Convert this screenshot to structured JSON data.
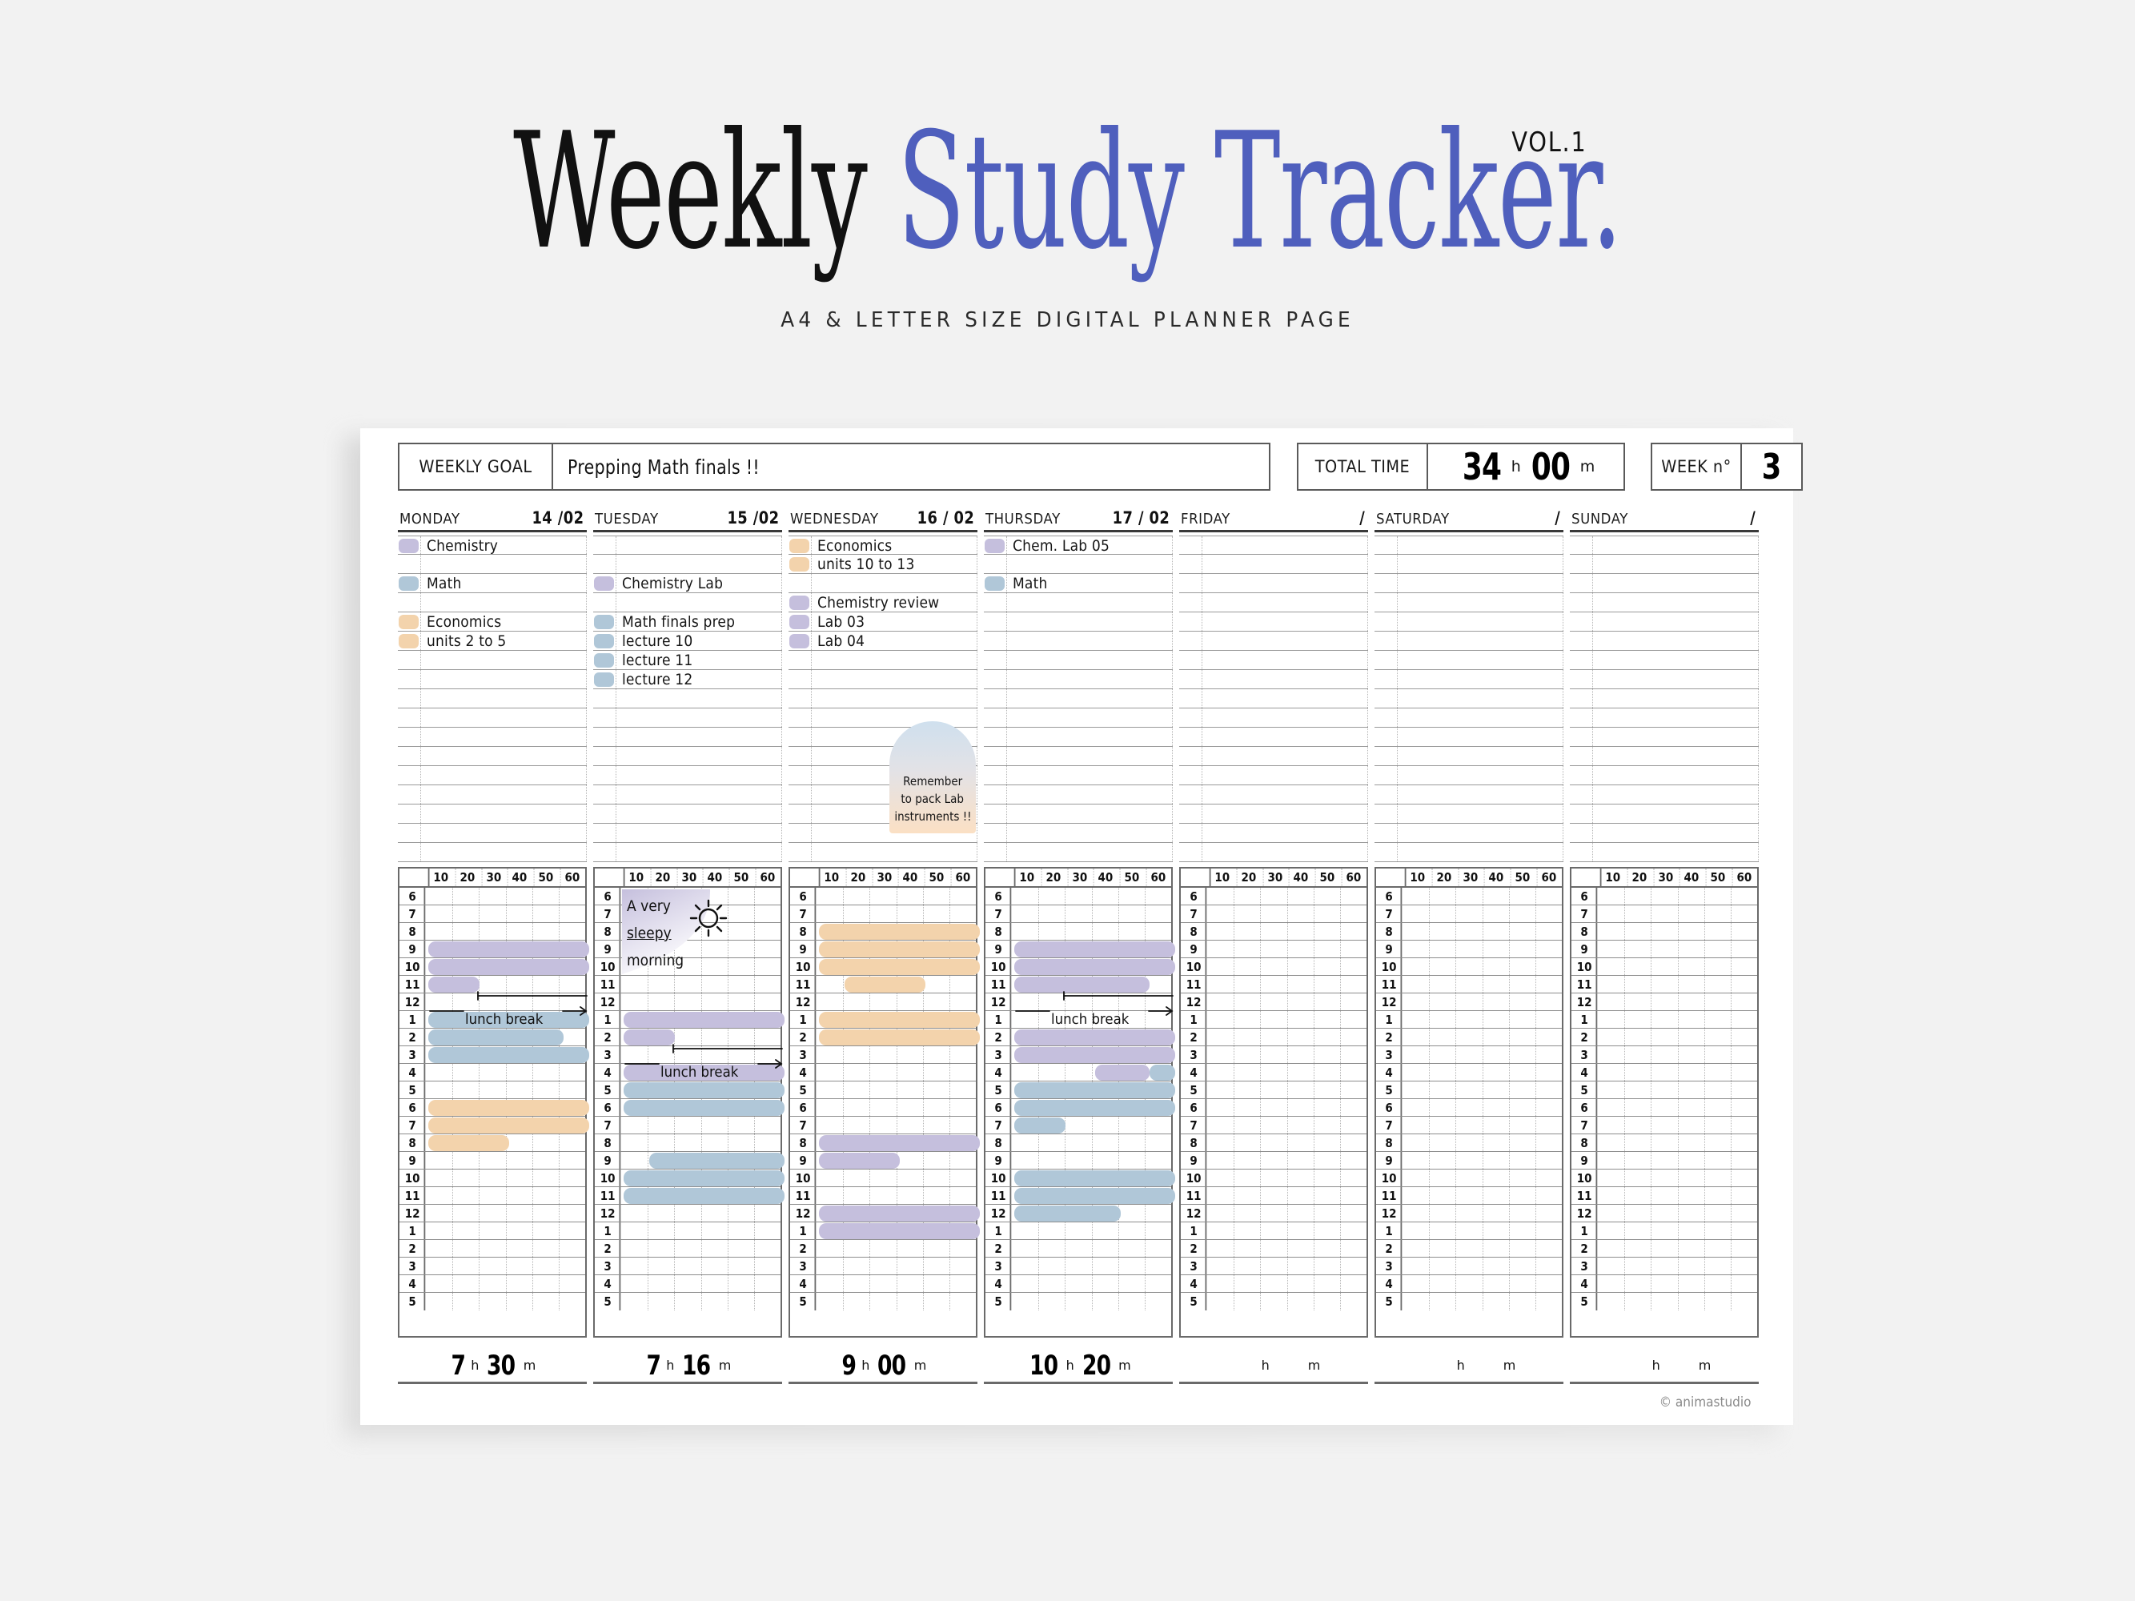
{
  "hero": {
    "title_part1": "Weekly",
    "title_part2": "Study Tracker",
    "title_dot": ".",
    "volume": "VOL.1",
    "subtitle": "A4 & LETTER SIZE DIGITAL PLANNER PAGE"
  },
  "header": {
    "weekly_goal_label": "WEEKLY GOAL",
    "weekly_goal_value": "Prepping Math finals !!",
    "total_time_label": "TOTAL TIME",
    "total_hours": "34",
    "total_hours_unit": "h",
    "total_minutes": "00",
    "total_minutes_unit": "m",
    "week_label": "WEEK n°",
    "week_value": "3"
  },
  "colors": {
    "purple": "#c5bfdd",
    "blue": "#b0c7d8",
    "orange": "#f3d3ac",
    "accent_blue": "#4f5fbd",
    "rule": "#6a6a6a"
  },
  "grid_header_minutes": [
    "10",
    "20",
    "30",
    "40",
    "50",
    "60"
  ],
  "grid_hours": [
    "6",
    "7",
    "8",
    "9",
    "10",
    "11",
    "12",
    "1",
    "2",
    "3",
    "4",
    "5",
    "6",
    "7",
    "8",
    "9",
    "10",
    "11",
    "12",
    "1",
    "2",
    "3",
    "4",
    "5"
  ],
  "days": [
    {
      "name": "MONDAY",
      "date": "14 /02",
      "tasks": [
        {
          "row": 0,
          "chip": "purple",
          "text": "Chemistry"
        },
        {
          "row": 2,
          "chip": "blue",
          "text": "Math"
        },
        {
          "row": 4,
          "chip": "orange",
          "text": "Economics"
        },
        {
          "row": 5,
          "chip": "orange",
          "text": "units 2 to 5"
        }
      ],
      "note": null,
      "sticker": null,
      "bars": [
        {
          "row": 3,
          "start": 0,
          "end": 100,
          "color": "purple"
        },
        {
          "row": 4,
          "start": 0,
          "end": 100,
          "color": "purple"
        },
        {
          "row": 5,
          "start": 0,
          "end": 32,
          "color": "purple"
        },
        {
          "row": 7,
          "start": 0,
          "end": 100,
          "color": "blue"
        },
        {
          "row": 8,
          "start": 0,
          "end": 84,
          "color": "blue"
        },
        {
          "row": 9,
          "start": 0,
          "end": 100,
          "color": "blue"
        },
        {
          "row": 12,
          "start": 0,
          "end": 100,
          "color": "orange"
        },
        {
          "row": 13,
          "start": 0,
          "end": 100,
          "color": "orange"
        },
        {
          "row": 14,
          "start": 0,
          "end": 50,
          "color": "orange"
        }
      ],
      "lunch": {
        "label": "lunch break",
        "row": 6
      },
      "total_hours": "7",
      "total_minutes": "30"
    },
    {
      "name": "TUESDAY",
      "date": "15 /02",
      "tasks": [
        {
          "row": 2,
          "chip": "purple",
          "text": "Chemistry Lab"
        },
        {
          "row": 4,
          "chip": "blue",
          "text": "Math finals prep"
        },
        {
          "row": 5,
          "chip": "blue",
          "text": "lecture 10"
        },
        {
          "row": 6,
          "chip": "blue",
          "text": "lecture 11"
        },
        {
          "row": 7,
          "chip": "blue",
          "text": "lecture 12"
        }
      ],
      "note": null,
      "sticker": {
        "lines": [
          "A very",
          "sleepy",
          "morning"
        ],
        "icon": "sun-icon"
      },
      "bars": [
        {
          "row": 7,
          "start": 0,
          "end": 100,
          "color": "purple"
        },
        {
          "row": 8,
          "start": 0,
          "end": 32,
          "color": "purple"
        },
        {
          "row": 10,
          "start": 0,
          "end": 100,
          "color": "purple"
        },
        {
          "row": 11,
          "start": 0,
          "end": 100,
          "color": "blue"
        },
        {
          "row": 12,
          "start": 0,
          "end": 100,
          "color": "blue"
        },
        {
          "row": 15,
          "start": 16,
          "end": 100,
          "color": "blue"
        },
        {
          "row": 16,
          "start": 0,
          "end": 100,
          "color": "blue"
        },
        {
          "row": 17,
          "start": 0,
          "end": 100,
          "color": "blue"
        }
      ],
      "lunch": {
        "label": "lunch break",
        "row": 9
      },
      "total_hours": "7",
      "total_minutes": "16"
    },
    {
      "name": "WEDNESDAY",
      "date": "16 / 02",
      "tasks": [
        {
          "row": 0,
          "chip": "orange",
          "text": "Economics"
        },
        {
          "row": 1,
          "chip": "orange",
          "text": "units 10 to 13"
        },
        {
          "row": 3,
          "chip": "purple",
          "text": "Chemistry review"
        },
        {
          "row": 4,
          "chip": "purple",
          "text": "Lab 03"
        },
        {
          "row": 5,
          "chip": "purple",
          "text": "Lab 04"
        }
      ],
      "note": {
        "lines": [
          "Remember",
          "to pack Lab",
          "instruments !!"
        ]
      },
      "sticker": null,
      "bars": [
        {
          "row": 2,
          "start": 0,
          "end": 100,
          "color": "orange"
        },
        {
          "row": 3,
          "start": 0,
          "end": 100,
          "color": "orange"
        },
        {
          "row": 4,
          "start": 0,
          "end": 100,
          "color": "orange"
        },
        {
          "row": 5,
          "start": 16,
          "end": 66,
          "color": "orange"
        },
        {
          "row": 7,
          "start": 0,
          "end": 100,
          "color": "orange"
        },
        {
          "row": 8,
          "start": 0,
          "end": 100,
          "color": "orange"
        },
        {
          "row": 14,
          "start": 0,
          "end": 100,
          "color": "purple"
        },
        {
          "row": 15,
          "start": 0,
          "end": 50,
          "color": "purple"
        },
        {
          "row": 18,
          "start": 0,
          "end": 100,
          "color": "purple"
        },
        {
          "row": 19,
          "start": 0,
          "end": 100,
          "color": "purple"
        }
      ],
      "lunch": null,
      "total_hours": "9",
      "total_minutes": "00"
    },
    {
      "name": "THURSDAY",
      "date": "17 / 02",
      "tasks": [
        {
          "row": 0,
          "chip": "purple",
          "text": "Chem. Lab 05"
        },
        {
          "row": 2,
          "chip": "blue",
          "text": "Math"
        }
      ],
      "note": null,
      "sticker": null,
      "bars": [
        {
          "row": 3,
          "start": 0,
          "end": 100,
          "color": "purple"
        },
        {
          "row": 4,
          "start": 0,
          "end": 100,
          "color": "purple"
        },
        {
          "row": 5,
          "start": 0,
          "end": 84,
          "color": "purple"
        },
        {
          "row": 8,
          "start": 0,
          "end": 100,
          "color": "purple"
        },
        {
          "row": 9,
          "start": 0,
          "end": 100,
          "color": "purple"
        },
        {
          "row": 10,
          "start": 50,
          "end": 84,
          "color": "purple"
        },
        {
          "row": 10,
          "start": 84,
          "end": 100,
          "color": "blue"
        },
        {
          "row": 11,
          "start": 0,
          "end": 100,
          "color": "blue"
        },
        {
          "row": 12,
          "start": 0,
          "end": 100,
          "color": "blue"
        },
        {
          "row": 13,
          "start": 0,
          "end": 32,
          "color": "blue"
        },
        {
          "row": 16,
          "start": 0,
          "end": 100,
          "color": "blue"
        },
        {
          "row": 17,
          "start": 0,
          "end": 100,
          "color": "blue"
        },
        {
          "row": 18,
          "start": 0,
          "end": 66,
          "color": "blue"
        }
      ],
      "lunch": {
        "label": "lunch break",
        "row": 6
      },
      "total_hours": "10",
      "total_minutes": "20"
    },
    {
      "name": "FRIDAY",
      "date": "/",
      "tasks": [],
      "note": null,
      "sticker": null,
      "bars": [],
      "lunch": null,
      "total_hours": "",
      "total_minutes": ""
    },
    {
      "name": "SATURDAY",
      "date": "/",
      "tasks": [],
      "note": null,
      "sticker": null,
      "bars": [],
      "lunch": null,
      "total_hours": "",
      "total_minutes": ""
    },
    {
      "name": "SUNDAY",
      "date": "/",
      "tasks": [],
      "note": null,
      "sticker": null,
      "bars": [],
      "lunch": null,
      "total_hours": "",
      "total_minutes": ""
    }
  ],
  "footer": {
    "hours_unit": "h",
    "minutes_unit": "m",
    "credit": "© animastudio"
  }
}
